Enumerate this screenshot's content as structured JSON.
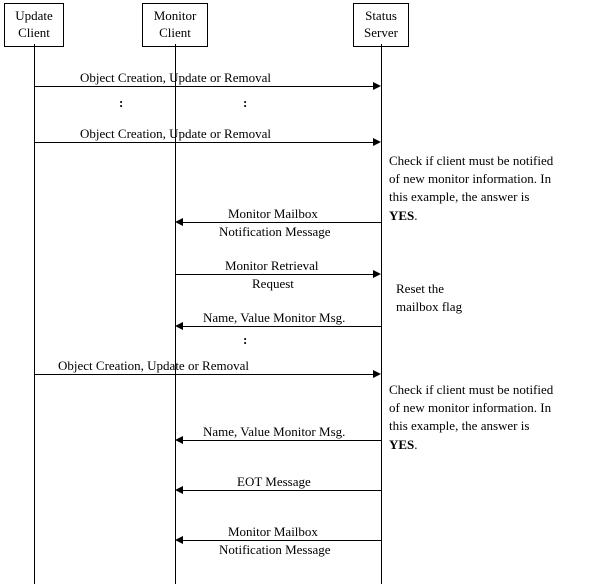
{
  "actors": {
    "update_client": "Update\nClient",
    "monitor_client": "Monitor\nClient",
    "status_server": "Status\nServer"
  },
  "messages": {
    "m1": "Object Creation, Update or Removal",
    "m2": "Object Creation, Update or Removal",
    "m3a": "Monitor Mailbox",
    "m3b": "Notification Message",
    "m4a": "Monitor Retrieval",
    "m4b": "Request",
    "m5": "Name, Value Monitor Msg.",
    "m6": "Object Creation, Update or Removal",
    "m7": "Name, Value Monitor Msg.",
    "m8": "EOT Message",
    "m9a": "Monitor Mailbox",
    "m9b": "Notification Message"
  },
  "notes": {
    "n1a": "Check if client must be notified",
    "n1b": "of new monitor information.  In",
    "n1c_prefix": "this example, the answer is ",
    "n1c_bold": "YES",
    "n1c_suffix": ".",
    "n2a": "Reset the",
    "n2b": "mailbox flag",
    "n3a": "Check if client must be notified",
    "n3b": "of new monitor information.  In",
    "n3c_prefix": "this example, the answer is ",
    "n3c_bold": "YES",
    "n3c_suffix": "."
  },
  "dots": ":"
}
